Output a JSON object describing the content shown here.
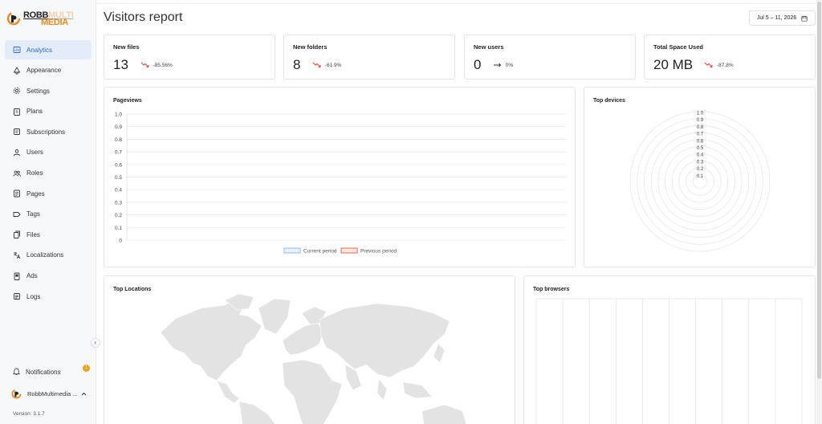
{
  "brand": {
    "line1_a": "ROBB",
    "line1_b": "MULTI",
    "line2": "MEDIA",
    "color": "#f08a1c"
  },
  "sidebar": {
    "items": [
      {
        "label": "Analytics",
        "icon": "chart-icon",
        "active": true
      },
      {
        "label": "Appearance",
        "icon": "palette-icon"
      },
      {
        "label": "Settings",
        "icon": "gear-icon"
      },
      {
        "label": "Plans",
        "icon": "clipboard-icon"
      },
      {
        "label": "Subscriptions",
        "icon": "receipt-icon"
      },
      {
        "label": "Users",
        "icon": "user-icon"
      },
      {
        "label": "Roles",
        "icon": "group-icon"
      },
      {
        "label": "Pages",
        "icon": "page-icon"
      },
      {
        "label": "Tags",
        "icon": "tag-icon"
      },
      {
        "label": "Files",
        "icon": "files-icon"
      },
      {
        "label": "Localizations",
        "icon": "translate-icon"
      },
      {
        "label": "Ads",
        "icon": "ads-icon"
      },
      {
        "label": "Logs",
        "icon": "log-icon"
      }
    ],
    "collapse_glyph": "‹",
    "notifications_label": "Notifications",
    "notifications_count": "1",
    "user_name": "RobbMultimedia ...",
    "version": "Version: 3.1.7"
  },
  "header": {
    "title": "Visitors report",
    "date_range": "Jul 5 – 11, 2026"
  },
  "stats": [
    {
      "title": "New files",
      "value": "13",
      "trend": "-85.56%",
      "direction": "down"
    },
    {
      "title": "New folders",
      "value": "8",
      "trend": "-61.9%",
      "direction": "down"
    },
    {
      "title": "New users",
      "value": "0",
      "trend": "0%",
      "direction": "flat"
    },
    {
      "title": "Total Space Used",
      "value": "20 MB",
      "trend": "-87.8%",
      "direction": "down"
    }
  ],
  "colors": {
    "down": "#e5484d",
    "accent": "#2d6ad8",
    "current": "#9ec5f4",
    "previous": "#f08060"
  },
  "chart_data": [
    {
      "type": "line",
      "title": "Pageviews",
      "y_ticks": [
        "1.0",
        "0.9",
        "0.8",
        "0.7",
        "0.6",
        "0.5",
        "0.4",
        "0.3",
        "0.2",
        "0.1",
        "0"
      ],
      "ylim": [
        0,
        1
      ],
      "grid": true,
      "series": [
        {
          "name": "Current period",
          "values": []
        },
        {
          "name": "Previous period",
          "values": []
        }
      ],
      "legend": "bottom"
    },
    {
      "type": "radar",
      "title": "Top devices",
      "r_ticks": [
        "1.0",
        "0.9",
        "0.8",
        "0.7",
        "0.6",
        "0.5",
        "0.4",
        "0.3",
        "0.2",
        "0.1"
      ],
      "rlim": [
        0,
        1
      ],
      "series": []
    },
    {
      "type": "map",
      "title": "Top Locations",
      "series": []
    },
    {
      "type": "bar",
      "title": "Top browsers",
      "categories": [],
      "series": []
    }
  ]
}
